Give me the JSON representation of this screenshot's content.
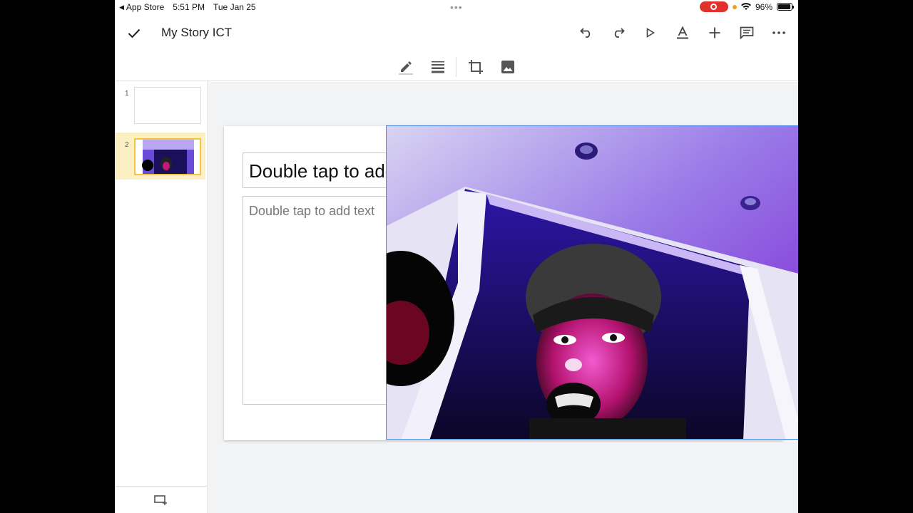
{
  "status_bar": {
    "back_label": "App Store",
    "time": "5:51 PM",
    "date": "Tue Jan 25",
    "battery": "96%"
  },
  "app_bar": {
    "title": "My Story ICT",
    "actions": [
      "undo-icon",
      "redo-icon",
      "present-icon",
      "text-format-icon",
      "add-icon",
      "comment-icon",
      "more-icon"
    ]
  },
  "format_bar": {
    "tools": [
      "pen-icon",
      "line-weight-icon",
      "crop-icon",
      "replace-image-icon"
    ]
  },
  "sidebar": {
    "slides": [
      {
        "number": "1",
        "selected": false
      },
      {
        "number": "2",
        "selected": true
      }
    ]
  },
  "slide": {
    "title_placeholder": "Double tap to add title",
    "body_placeholder": "Double tap to add text"
  },
  "colors": {
    "accent": "#1a73e8",
    "selected_slide": "#fcefc4",
    "record": "#e0312c"
  }
}
